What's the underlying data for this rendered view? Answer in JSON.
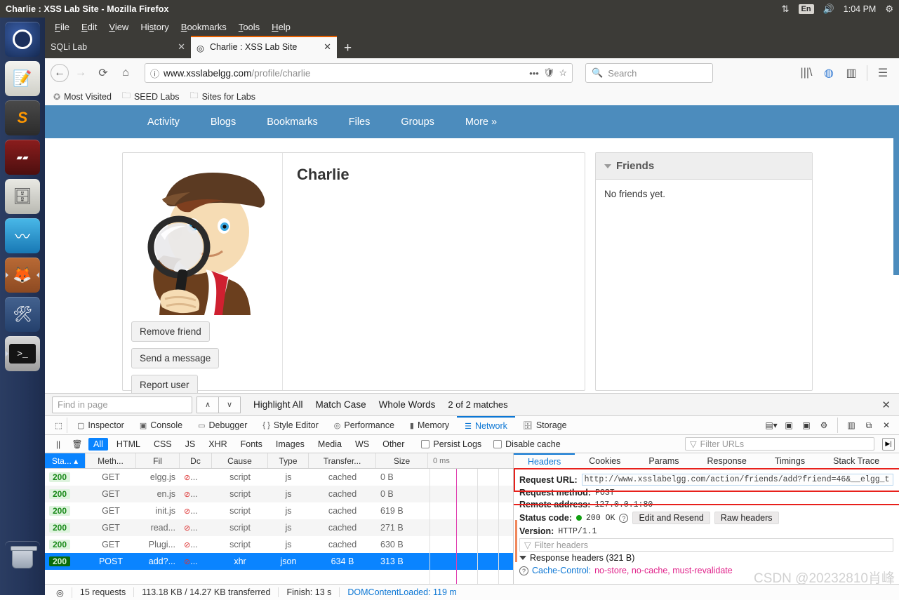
{
  "system": {
    "window_title": "Charlie : XSS Lab Site - Mozilla Firefox",
    "tray": {
      "network_icon": "network-icon",
      "language": "En",
      "volume_icon": "volume-icon",
      "clock": "1:04 PM",
      "gear_icon": "gear-icon"
    }
  },
  "launcher": {
    "items": [
      {
        "name": "ubuntu-dash",
        "label": "Dash"
      },
      {
        "name": "text-editor",
        "label": "Text Editor"
      },
      {
        "name": "sublime-text",
        "label": "S"
      },
      {
        "name": "terminator",
        "label": "Terminator"
      },
      {
        "name": "files",
        "label": "Files"
      },
      {
        "name": "wireshark",
        "label": "Wireshark"
      },
      {
        "name": "firefox",
        "label": "Firefox"
      },
      {
        "name": "system-settings",
        "label": "System Settings"
      },
      {
        "name": "terminal",
        "label": ">_"
      },
      {
        "name": "trash",
        "label": "Trash"
      }
    ]
  },
  "browser": {
    "menu": [
      "File",
      "Edit",
      "View",
      "History",
      "Bookmarks",
      "Tools",
      "Help"
    ],
    "tabs": [
      {
        "title": "SQLi Lab",
        "active": false
      },
      {
        "title": "Charlie : XSS Lab Site",
        "active": true
      }
    ],
    "new_tab_label": "+",
    "url": {
      "host": "www.xsslabelgg.com",
      "path": "/profile/charlie"
    },
    "search_placeholder": "Search",
    "bookmarks": [
      "Most Visited",
      "SEED Labs",
      "Sites for Labs"
    ]
  },
  "site": {
    "nav": [
      "Activity",
      "Blogs",
      "Bookmarks",
      "Files",
      "Groups",
      "More  »"
    ],
    "profile": {
      "name": "Charlie",
      "buttons": [
        "Remove friend",
        "Send a message",
        "Report user"
      ]
    },
    "friends_widget": {
      "title": "Friends",
      "body": "No friends yet."
    }
  },
  "findbar": {
    "placeholder": "Find in page",
    "prev_label": "∧",
    "next_label": "∨",
    "highlight_all": "Highlight All",
    "match_case": "Match Case",
    "whole_words": "Whole Words",
    "matches": "2 of 2 matches",
    "close": "✕"
  },
  "devtools": {
    "tabs": [
      {
        "label": "Inspector",
        "icon": "inspector-icon",
        "selected": false
      },
      {
        "label": "Console",
        "icon": "console-icon",
        "selected": false
      },
      {
        "label": "Debugger",
        "icon": "debugger-icon",
        "selected": false
      },
      {
        "label": "Style Editor",
        "icon": "style-editor-icon",
        "selected": false
      },
      {
        "label": "Performance",
        "icon": "performance-icon",
        "selected": false
      },
      {
        "label": "Memory",
        "icon": "memory-icon",
        "selected": false
      },
      {
        "label": "Network",
        "icon": "network-icon",
        "selected": true
      },
      {
        "label": "Storage",
        "icon": "storage-icon",
        "selected": false
      }
    ],
    "filters": [
      "All",
      "HTML",
      "CSS",
      "JS",
      "XHR",
      "Fonts",
      "Images",
      "Media",
      "WS",
      "Other"
    ],
    "active_filter": "All",
    "persist_logs": "Persist Logs",
    "disable_cache": "Disable cache",
    "filter_urls_placeholder": "Filter URLs",
    "columns": [
      "Sta...",
      "Meth...",
      "Fil",
      "Dc",
      "Cause",
      "Type",
      "Transfer...",
      "Size"
    ],
    "sorted_column": "Sta...",
    "timeline_label": "0 ms",
    "requests": [
      {
        "status": "200",
        "method": "GET",
        "file": "elgg.js",
        "domain": "...",
        "cause": "script",
        "type": "js",
        "transferred": "cached",
        "size": "0 B",
        "selected": false
      },
      {
        "status": "200",
        "method": "GET",
        "file": "en.js",
        "domain": "...",
        "cause": "script",
        "type": "js",
        "transferred": "cached",
        "size": "0 B",
        "selected": false
      },
      {
        "status": "200",
        "method": "GET",
        "file": "init.js",
        "domain": "...",
        "cause": "script",
        "type": "js",
        "transferred": "cached",
        "size": "619 B",
        "selected": false
      },
      {
        "status": "200",
        "method": "GET",
        "file": "read...",
        "domain": "...",
        "cause": "script",
        "type": "js",
        "transferred": "cached",
        "size": "271 B",
        "selected": false
      },
      {
        "status": "200",
        "method": "GET",
        "file": "Plugi...",
        "domain": "...",
        "cause": "script",
        "type": "js",
        "transferred": "cached",
        "size": "630 B",
        "selected": false
      },
      {
        "status": "200",
        "method": "POST",
        "file": "add?...",
        "domain": "...",
        "cause": "xhr",
        "type": "json",
        "transferred": "634 B",
        "size": "313 B",
        "selected": true
      }
    ],
    "detail": {
      "tabs": [
        "Headers",
        "Cookies",
        "Params",
        "Response",
        "Timings",
        "Stack Trace"
      ],
      "selected_tab": "Headers",
      "request_url_label": "Request URL:",
      "request_url_value": "http://www.xsslabelgg.com/action/friends/add?friend=46&__elgg_t",
      "request_method_label": "Request method:",
      "request_method_value": "POST",
      "remote_address_label": "Remote address:",
      "remote_address_value": "127.0.0.1:80",
      "status_code_label": "Status code:",
      "status_code_value": "200 OK",
      "edit_and_resend": "Edit and Resend",
      "raw_headers": "Raw headers",
      "version_label": "Version:",
      "version_value": "HTTP/1.1",
      "filter_headers_placeholder": "Filter headers",
      "response_headers_title": "Response headers (321 B)",
      "cache_control_name": "Cache-Control:",
      "cache_control_value": "no-store, no-cache, must-revalidate"
    },
    "status_bar": {
      "requests": "15 requests",
      "transferred": "113.18 KB / 14.27 KB transferred",
      "finish": "Finish: 13 s",
      "domcontentloaded": "DOMContentLoaded: 119 m"
    }
  },
  "watermark": "CSDN @20232810肖峰",
  "colors": {
    "accent_blue": "#0a84ff",
    "elgg_blue": "#4c8cbd",
    "panel_dark": "#3c3b37",
    "status_green": "#1a8a1a",
    "annotation_red": "#e8201b",
    "header_pink": "#e0218a"
  }
}
